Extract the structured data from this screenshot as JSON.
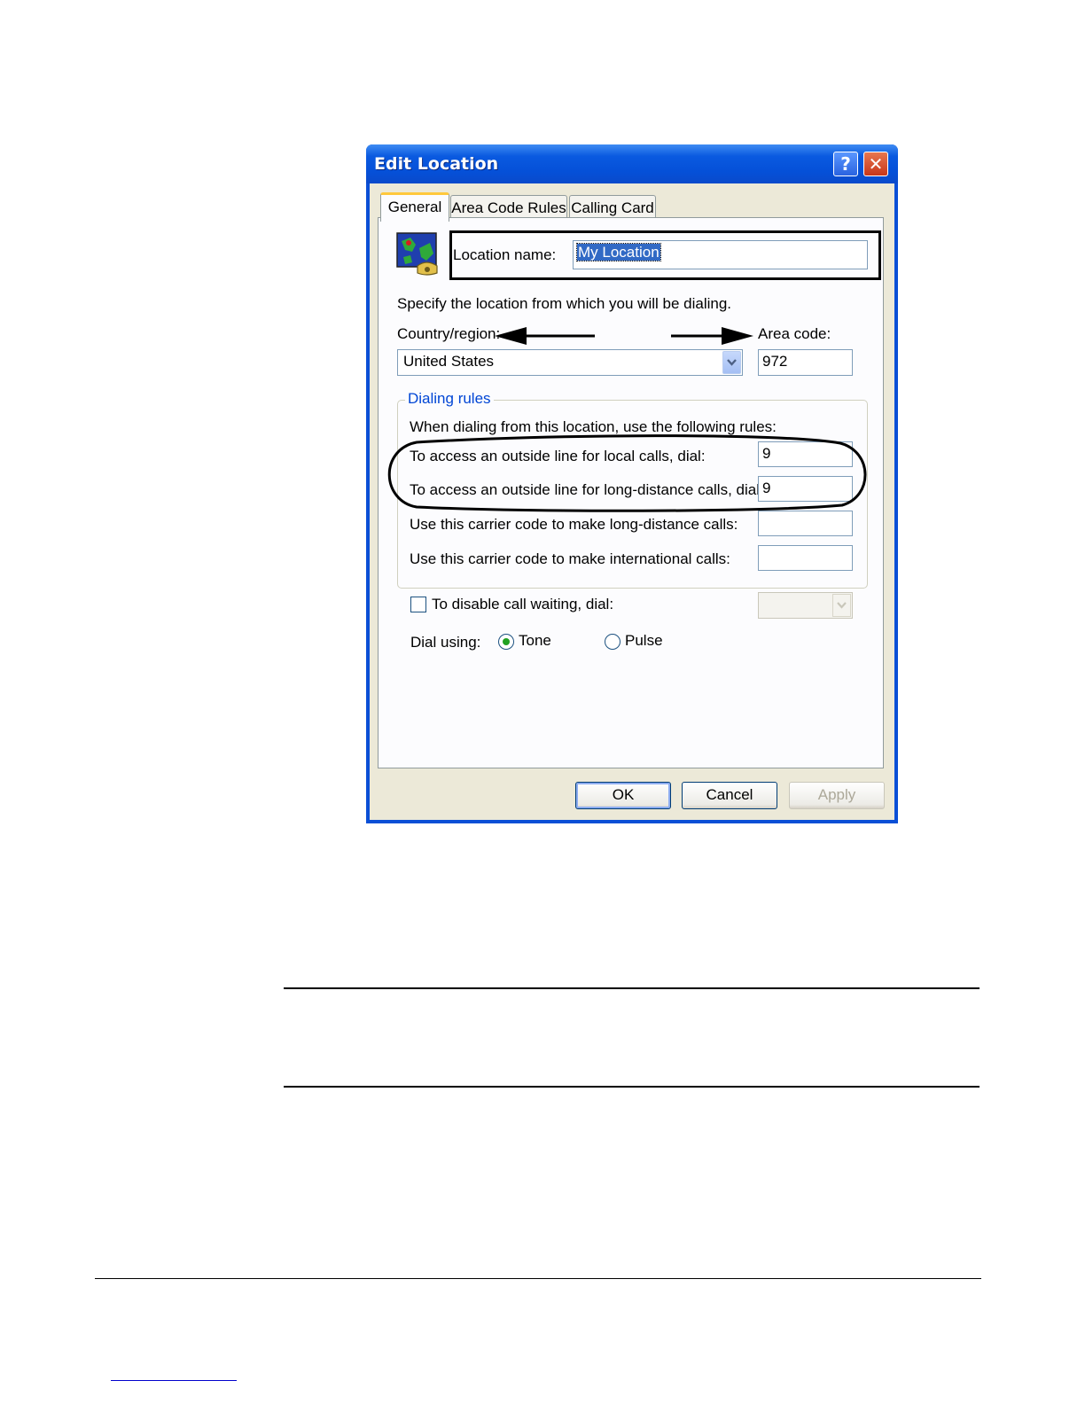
{
  "dialog": {
    "title": "Edit Location",
    "help_button": "?",
    "close_button": "✕",
    "tabs": [
      {
        "label": "General",
        "active": true
      },
      {
        "label": "Area Code Rules",
        "active": false
      },
      {
        "label": "Calling Card",
        "active": false
      }
    ],
    "location_name_label": "Location name:",
    "location_name_value": "My Location",
    "specify_text": "Specify the location from which you will be dialing.",
    "country_label": "Country/region:",
    "country_value": "United States",
    "area_code_label": "Area code:",
    "area_code_value": "972",
    "dialing_rules": {
      "title": "Dialing rules",
      "intro": "When dialing from this location, use the following rules:",
      "rows": [
        {
          "label": "To access an outside line for local calls, dial:",
          "value": "9"
        },
        {
          "label": "To access an outside line for long-distance calls, dial:",
          "value": "9"
        },
        {
          "label": "Use this carrier code to make long-distance calls:",
          "value": ""
        },
        {
          "label": "Use this carrier code to make international calls:",
          "value": ""
        }
      ]
    },
    "call_waiting_label": "To disable call waiting, dial:",
    "call_waiting_checked": false,
    "dial_using_label": "Dial using:",
    "dial_options": [
      {
        "label": "Tone",
        "selected": true
      },
      {
        "label": "Pulse",
        "selected": false
      }
    ],
    "buttons": {
      "ok": "OK",
      "cancel": "Cancel",
      "apply": "Apply"
    }
  },
  "colors": {
    "titlebar": "#0a5ae0",
    "client_bg": "#ece9d8",
    "group_title": "#0046d5",
    "selection": "#316ac5"
  }
}
